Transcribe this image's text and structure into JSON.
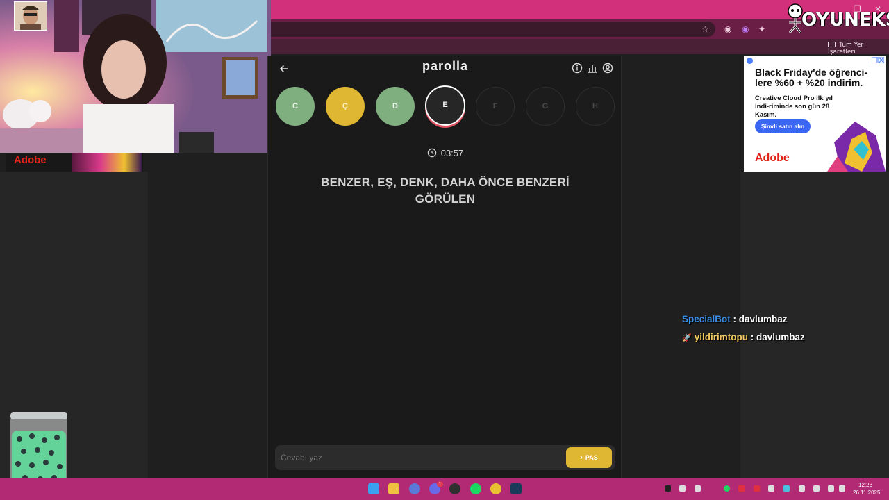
{
  "browser": {
    "bookmarks_label": "Tüm Yer İşaretleri"
  },
  "brand": {
    "name": "OYUNEKS"
  },
  "game": {
    "title": "parolla",
    "letters": [
      {
        "char": "C",
        "state": "correct"
      },
      {
        "char": "Ç",
        "state": "skipped"
      },
      {
        "char": "D",
        "state": "correct"
      },
      {
        "char": "E",
        "state": "active"
      },
      {
        "char": "F",
        "state": "pending"
      },
      {
        "char": "G",
        "state": "pending"
      },
      {
        "char": "H",
        "state": "pending"
      }
    ],
    "timer": "03:57",
    "question": "BENZER, EŞ, DENK, DAHA ÖNCE BENZERİ GÖRÜLEN",
    "answer_placeholder": "Cevabı yaz",
    "pass_label": "PAS"
  },
  "ad_left": {
    "brand": "Adobe"
  },
  "ad_right": {
    "headline": "Black Friday'de öğrenci-lere %60 + %20 indirim.",
    "body": "Creative Cloud Pro ilk yıl indi-riminde son gün 28 Kasım.",
    "cta": "Şimdi satın alın",
    "brand": "Adobe"
  },
  "chat": {
    "messages": [
      {
        "user": "SpecialBot",
        "text": " : davlumbaz"
      },
      {
        "user": "yildirimtopu",
        "text": " : davlumbaz"
      }
    ]
  },
  "taskbar": {
    "time": "12:23",
    "date": "26.11.2025",
    "notification_count": "1"
  },
  "colors": {
    "correct": "#7fae7f",
    "skipped": "#e0b733",
    "active_ring": "#e05060",
    "taskbar": "#b12a73"
  }
}
